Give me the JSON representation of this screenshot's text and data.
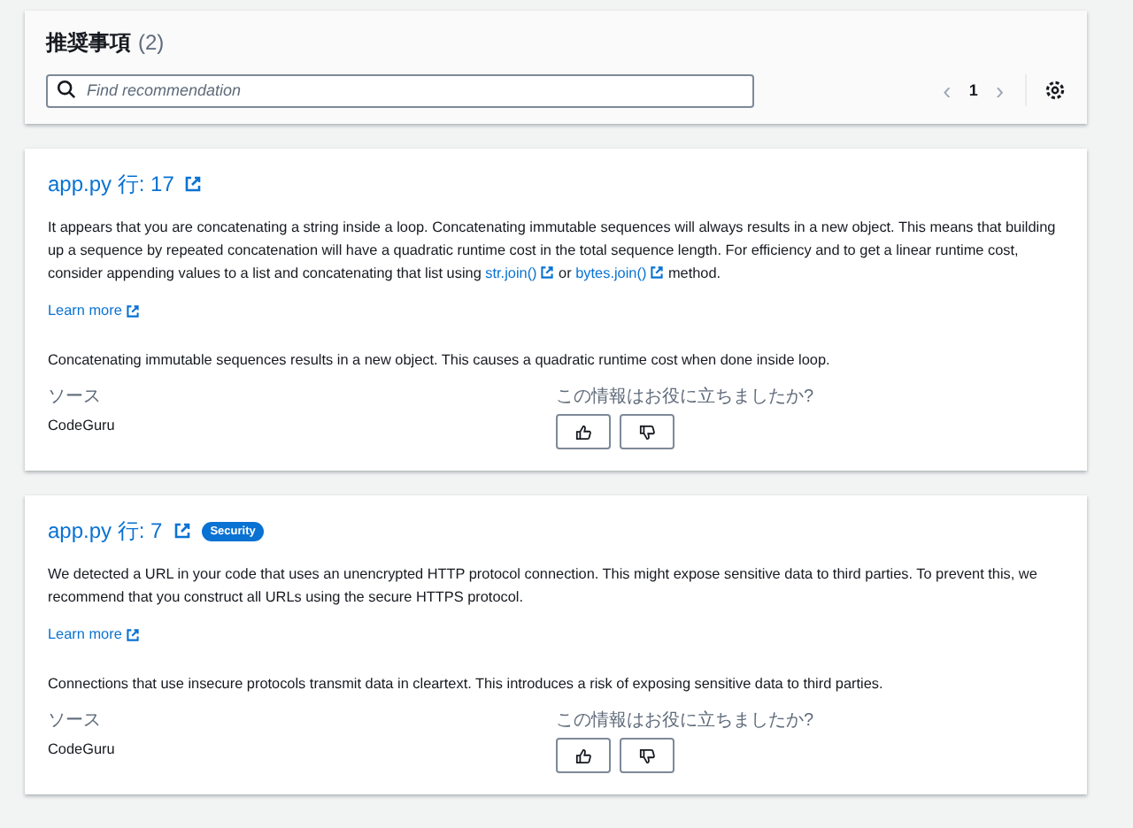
{
  "header": {
    "title": "推奨事項",
    "count": "(2)",
    "search": {
      "placeholder": "Find recommendation"
    },
    "pagination": {
      "prev": "‹",
      "page": "1",
      "next": "›"
    }
  },
  "recommendations": [
    {
      "file": "app.py 行: 17",
      "description": [
        {
          "kind": "text",
          "text": "It appears that you are concatenating a string inside a loop. Concatenating immutable sequences will always results in a new object. This means that building up a sequence by repeated concatenation will have a quadratic runtime cost in the total sequence length. For efficiency and to get a linear runtime cost, consider appending values to a list and concatenating that list using "
        },
        {
          "kind": "link",
          "text": "str.join()"
        },
        {
          "kind": "text",
          "text": " or "
        },
        {
          "kind": "link",
          "text": "bytes.join()"
        },
        {
          "kind": "text",
          "text": " method."
        }
      ],
      "learn_more": "Learn more",
      "summary": "Concatenating immutable sequences results in a new object. This causes a quadratic runtime cost when done inside loop.",
      "source_label": "ソース",
      "source": "CodeGuru",
      "feedback_label": "この情報はお役に立ちましたか?"
    },
    {
      "file": "app.py 行: 7",
      "badge": "Security",
      "description": [
        {
          "kind": "text",
          "text": "We detected a URL in your code that uses an unencrypted HTTP protocol connection. This might expose sensitive data to third parties. To prevent this, we recommend that you construct all URLs using the secure HTTPS protocol."
        }
      ],
      "learn_more": "Learn more",
      "summary": "Connections that use insecure protocols transmit data in cleartext. This introduces a risk of exposing sensitive data to third parties.",
      "source_label": "ソース",
      "source": "CodeGuru",
      "feedback_label": "この情報はお役に立ちましたか?"
    }
  ]
}
